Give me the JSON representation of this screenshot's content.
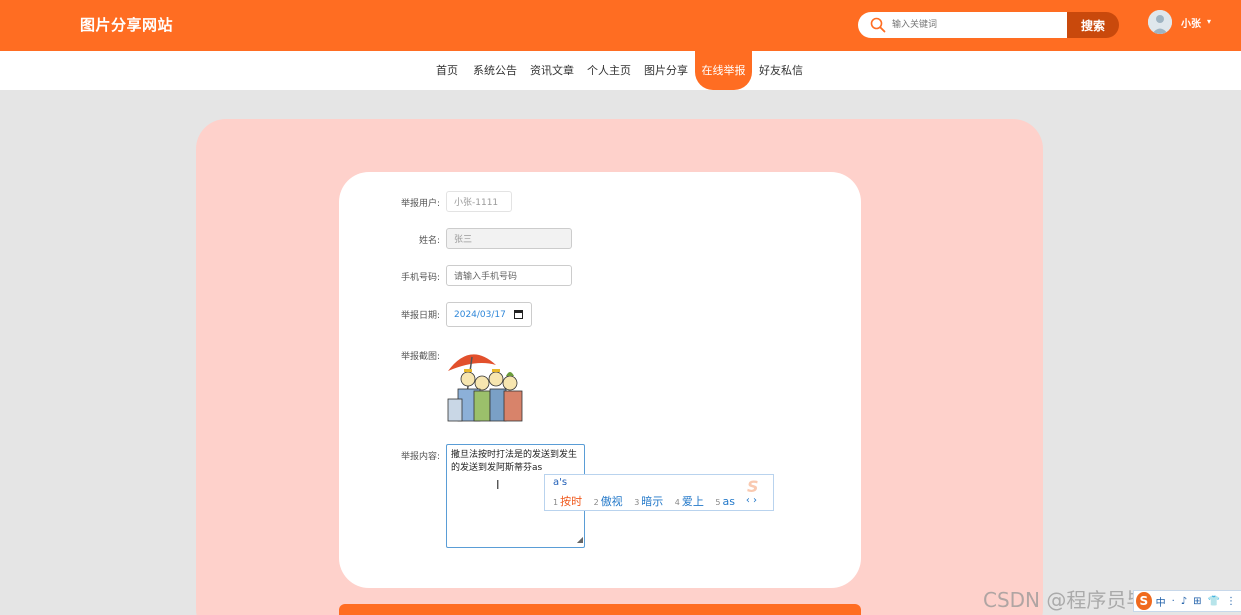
{
  "header": {
    "site_title": "图片分享网站",
    "search_placeholder": "输入关键词",
    "search_button": "搜索",
    "username": "小张",
    "caret": "▾",
    "brand_color": "#ff6d22"
  },
  "nav": {
    "items": [
      {
        "label": "首页"
      },
      {
        "label": "系统公告"
      },
      {
        "label": "资讯文章"
      },
      {
        "label": "个人主页"
      },
      {
        "label": "图片分享"
      },
      {
        "label": "在线举报"
      },
      {
        "label": "好友私信"
      }
    ],
    "active_index": 5
  },
  "form": {
    "reporter_label": "举报用户:",
    "reporter_value": "小张-1111",
    "name_label": "姓名:",
    "name_value": "张三",
    "phone_label": "手机号码:",
    "phone_placeholder": "请输入手机号码",
    "date_label": "举报日期:",
    "date_value": "2024/03/17",
    "screenshot_label": "举报截图:",
    "content_label": "举报内容:",
    "content_value": "撒旦法按时打法是的发送到发生的发送到发阿斯蒂芬as",
    "resize_grip": "◢"
  },
  "ime": {
    "input": "a's",
    "candidates": [
      {
        "num": "1",
        "text": "按时"
      },
      {
        "num": "2",
        "text": "傲视"
      },
      {
        "num": "3",
        "text": "暗示"
      },
      {
        "num": "4",
        "text": "爱上"
      },
      {
        "num": "5",
        "text": "as"
      }
    ],
    "nav": "‹ ›",
    "logo": "S"
  },
  "ime_toolbar": {
    "logo": "S",
    "items": [
      "中",
      "·",
      "♪",
      "⊞",
      "👕",
      "⋮"
    ]
  },
  "watermark": "CSDN @程序员毕业设计"
}
